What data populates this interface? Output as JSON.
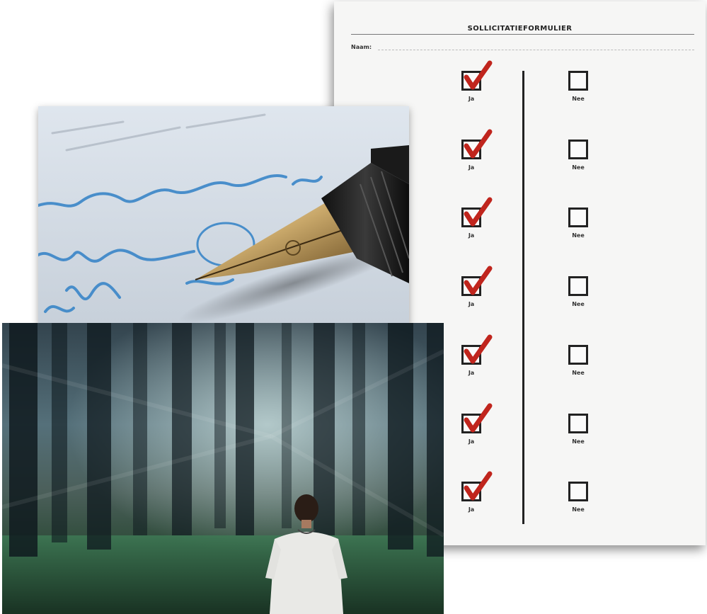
{
  "form": {
    "title": "SOLLICITATIEFORMULIER",
    "name_label": "Naam:",
    "rows": [
      {
        "yes_label": "Ja",
        "no_label": "Nee",
        "yes_checked": true,
        "no_checked": false
      },
      {
        "yes_label": "Ja",
        "no_label": "Nee",
        "yes_checked": true,
        "no_checked": false
      },
      {
        "yes_label": "Ja",
        "no_label": "Nee",
        "yes_checked": true,
        "no_checked": false
      },
      {
        "yes_label": "Ja",
        "no_label": "Nee",
        "yes_checked": true,
        "no_checked": false
      },
      {
        "yes_label": "Ja",
        "no_label": "Nee",
        "yes_checked": true,
        "no_checked": false
      },
      {
        "yes_label": "Ja",
        "no_label": "Nee",
        "yes_checked": true,
        "no_checked": false
      },
      {
        "yes_label": "Ja",
        "no_label": "Nee",
        "yes_checked": true,
        "no_checked": false
      }
    ]
  },
  "colors": {
    "check_mark": "#c0251d",
    "ink": "#3a86c8",
    "paper": "#f6f6f5"
  }
}
